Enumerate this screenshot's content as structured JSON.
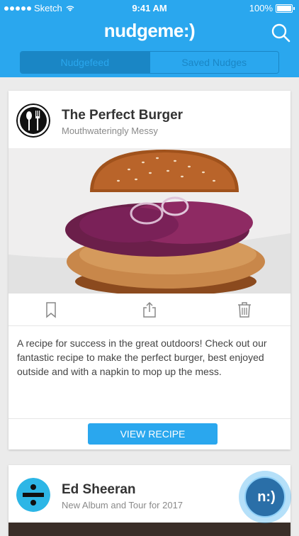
{
  "status_bar": {
    "carrier": "Sketch",
    "time": "9:41 AM",
    "battery": "100%"
  },
  "header": {
    "logo": "nudgeme:)",
    "tabs": [
      {
        "label": "Nudgefeed",
        "active": true
      },
      {
        "label": "Saved Nudges",
        "active": false
      }
    ]
  },
  "cards": [
    {
      "title": "The Perfect Burger",
      "subtitle": "Mouthwateringly Messy",
      "description": "A recipe for success in the great outdoors! Check out our fantastic recipe to make the perfect burger, best enjoyed outside and with a napkin to mop up the mess.",
      "button": "VIEW RECIPE",
      "icon": "fork-knife-icon"
    },
    {
      "title": "Ed Sheeran",
      "subtitle": "New Album and Tour for 2017",
      "icon": "divide-icon"
    }
  ],
  "fab": {
    "label": "n:)"
  },
  "colors": {
    "primary": "#2aa7ee",
    "dark": "#1a86c5",
    "text": "#333333",
    "muted": "#8a8a8a"
  }
}
